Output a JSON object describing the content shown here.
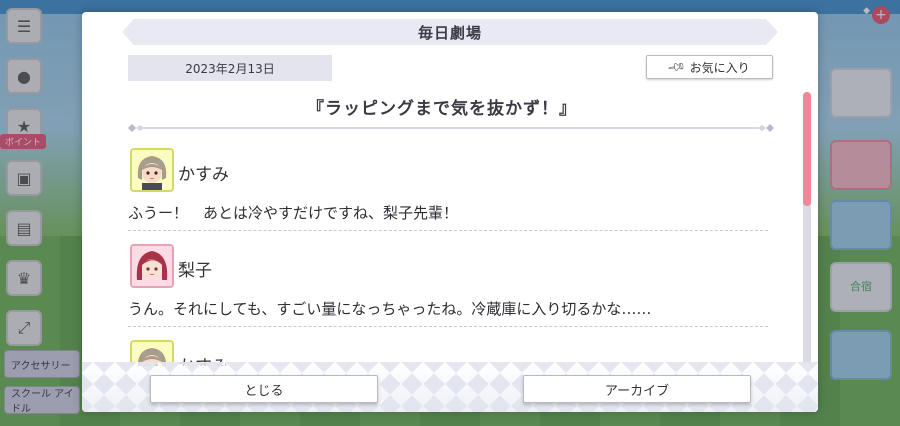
{
  "modal": {
    "title": "毎日劇場",
    "date": "2023年2月13日",
    "favorite_label": "お気に入り",
    "story_title": "『ラッピングまで気を抜かず！』",
    "entries": [
      {
        "speaker": "かすみ",
        "text": "ふうー！　あとは冷やすだけですね、梨子先輩！",
        "avatar": "kasumi-avatar"
      },
      {
        "speaker": "梨子",
        "text": "うん。それにしても、すごい量になっちゃったね。冷蔵庫に入り切るかな……",
        "avatar": "riko-avatar"
      },
      {
        "speaker": "かすみ",
        "text": "",
        "avatar": "kasumi-avatar"
      }
    ],
    "close_label": "とじる",
    "archive_label": "アーカイブ"
  },
  "background": {
    "event_label": "ボイント",
    "sidebar_tags": [
      "アクセサリー",
      "スクール アイドル"
    ],
    "right_tiles": [
      "合宿"
    ]
  },
  "colors": {
    "accent": "#ee8797",
    "header_bg": "#e8e9f1",
    "text": "#3a3a44"
  },
  "icons": {
    "favorite": "pin-icon",
    "menu": "hamburger-icon"
  }
}
